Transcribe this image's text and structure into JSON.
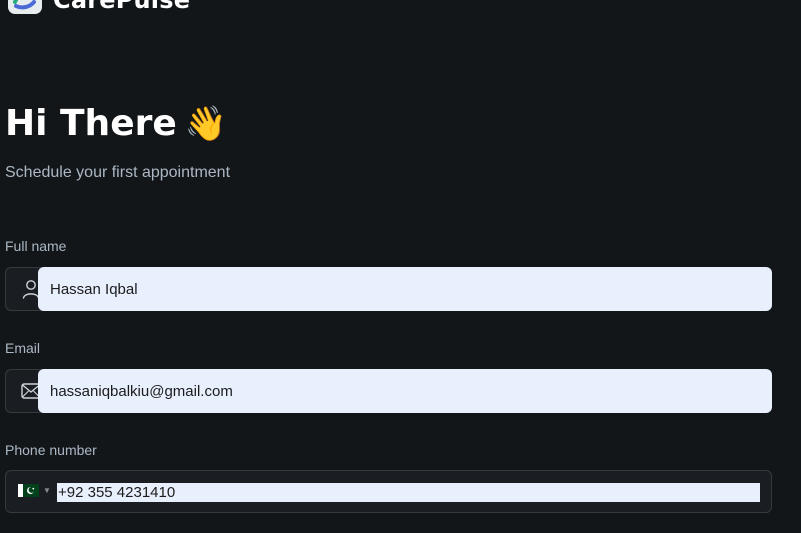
{
  "brand": {
    "name": "CarePulse",
    "logo_icon": "carepulse-logo-icon"
  },
  "header": {
    "greeting": "Hi There",
    "greeting_emoji": "👋",
    "subtitle": "Schedule your first appointment"
  },
  "form": {
    "full_name": {
      "label": "Full name",
      "value": "Hassan Iqbal",
      "icon": "user-icon"
    },
    "email": {
      "label": "Email",
      "value": "hassaniqbalkiu@gmail.com",
      "icon": "mail-icon"
    },
    "phone": {
      "label": "Phone number",
      "country": "PK",
      "value": "+92 355 4231410",
      "flag_icon": "pakistan-flag-icon"
    }
  },
  "colors": {
    "background": "#131619",
    "field_background": "#1a1d21",
    "field_border": "#363a3d",
    "autofill": "#e8f0fe",
    "muted_text": "#abb8c4",
    "brand_green": "#24ae7c"
  }
}
